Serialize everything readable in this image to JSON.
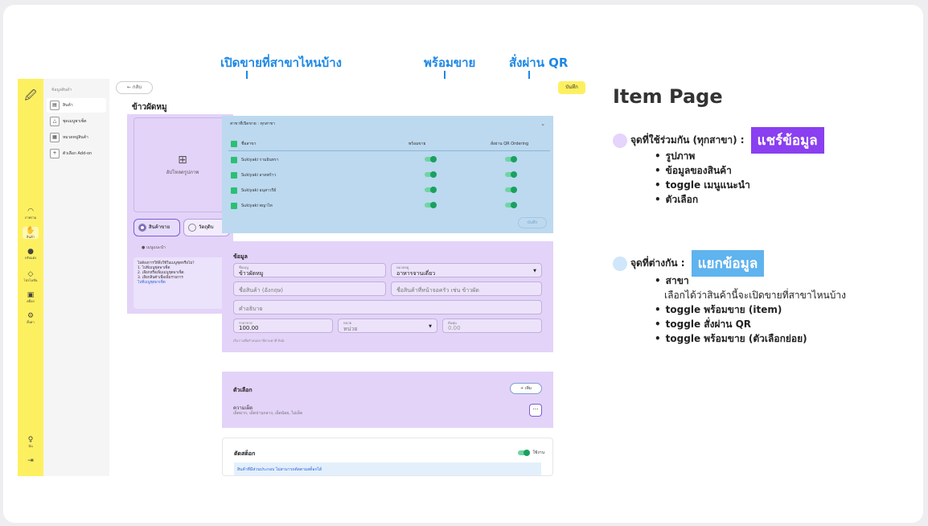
{
  "annotations": {
    "branch_open": "เปิดขายที่สาขาไหนบ้าง",
    "ready": "พร้อมขาย",
    "qr": "สั่งผ่าน QR"
  },
  "rail": {
    "items": [
      {
        "icon": "dashboard-icon",
        "label": "ภาพรวม"
      },
      {
        "icon": "hand-icon",
        "label": "สินค้า"
      },
      {
        "icon": "palette-icon",
        "label": "ปรับแต่ง"
      },
      {
        "icon": "tag-icon",
        "label": "โปรโมชั่น"
      },
      {
        "icon": "store-icon",
        "label": "สต็อก"
      },
      {
        "icon": "gear-icon",
        "label": "ตั้งค่า"
      }
    ],
    "user_label": "ฉัน"
  },
  "subnav": {
    "heading": "ข้อมูลสินค้า",
    "items": [
      "สินค้า",
      "ชุดเมนูพาเซ็ต",
      "หมวดหมู่สินค้า",
      "ตัวเลือก Add-on"
    ]
  },
  "topbar": {
    "back": "← กลับ",
    "save": "บันทึก"
  },
  "page_title": "ข้าวผัดหมู",
  "left": {
    "upload": "อัปโหลดรูปภาพ",
    "radio_product": "สินค้าขาย",
    "radio_material": "วัตถุดิบ",
    "recommended": "เมนูแนะนำ",
    "help_title": "ไม่ต้องการให้สิ่งใช้ในเมนูชุดหรือไม่?",
    "help_lines": [
      "1. ไปที่เมนูชุดพาเซ็ต",
      "2. เลือกหรือเพิ่มเมนูชุดพาเซ็ต",
      "3. เลือกสินค้าเพื่อเพิ่มรายการ"
    ],
    "help_link": "ไปที่เมนูชุดพาเซ็ต"
  },
  "branch": {
    "header": "สาขาที่เปิดขาย : ทุกสาขา",
    "col_name": "ชื่อสาขา",
    "col_ready": "พร้อมขาย",
    "col_qr": "สั่งผ่าน QR Ordering",
    "rows": [
      "Sukiyaki รามอินทรา",
      "Sukiyaki ลาดพร้าว",
      "Sukiyaki อนุสาวรีย์",
      "Sukiyaki พญาไท"
    ],
    "save": "บันทึก"
  },
  "info": {
    "title": "ข้อมูล",
    "name_label": "ชื่อเมนู",
    "name_value": "ข้าวผัดหมู",
    "category_label": "หมวดหมู่",
    "category_value": "อาหารจานเดี่ยว",
    "name_en_ph": "ชื่อสินค้า (อังกฤษ)",
    "short_ph": "ชื่อสินค้าที่หน้าจอครัว เช่น ข้าวผัด",
    "desc_ph": "คำอธิบาย",
    "price_label": "ราคาขาย",
    "price_value": "100.00",
    "unit_label": "หน่วย",
    "unit_ph": "หน่วย",
    "cost_label": "ต้นทุน",
    "cost_ph": "0.00",
    "footnote": "เริ่มว่างเพื่อกำหนดภาษีตามค่าที่ Hub"
  },
  "options": {
    "title": "ตัวเลือก",
    "add": "+ เพิ่ม",
    "item_name": "ความเผ็ด",
    "item_values": "เผ็ดมาก, เผ็ดปานกลาง, เผ็ดน้อย, ไม่เผ็ด"
  },
  "stock": {
    "title": "ตัดสต็อก",
    "toggle_label": "ใช้งาน",
    "notice": "สินค้าที่มีส่วนประกอบ ไม่สามารถตัดตามสต็อกได้"
  },
  "right": {
    "title": "Item Page",
    "shared_head": "จุดที่ใช้ร่วมกัน (ทุกสาขา) :",
    "shared_tag": "แชร์ข้อมูล",
    "shared_items": [
      "รูปภาพ",
      "ข้อมูลของสินค้า",
      "toggle เมนูแนะนำ",
      "ตัวเลือก"
    ],
    "diff_head": "จุดที่ต่างกัน :",
    "diff_tag": "แยกข้อมูล",
    "diff_item1": "สาขา",
    "diff_item1_sub": "เลือกได้ว่าสินค้านี้จะเปิดขายที่สาขาไหนบ้าง",
    "diff_items": [
      "toggle พร้อมขาย (item)",
      "toggle สั่งผ่าน QR",
      "toggle พร้อมขาย (ตัวเลือกย่อย)"
    ],
    "colors": {
      "shared_tag": "#8a3ff0",
      "diff_tag": "#5fb3ee",
      "shared_dot": "#e5d4fb",
      "diff_dot": "#cfe6fb"
    }
  }
}
